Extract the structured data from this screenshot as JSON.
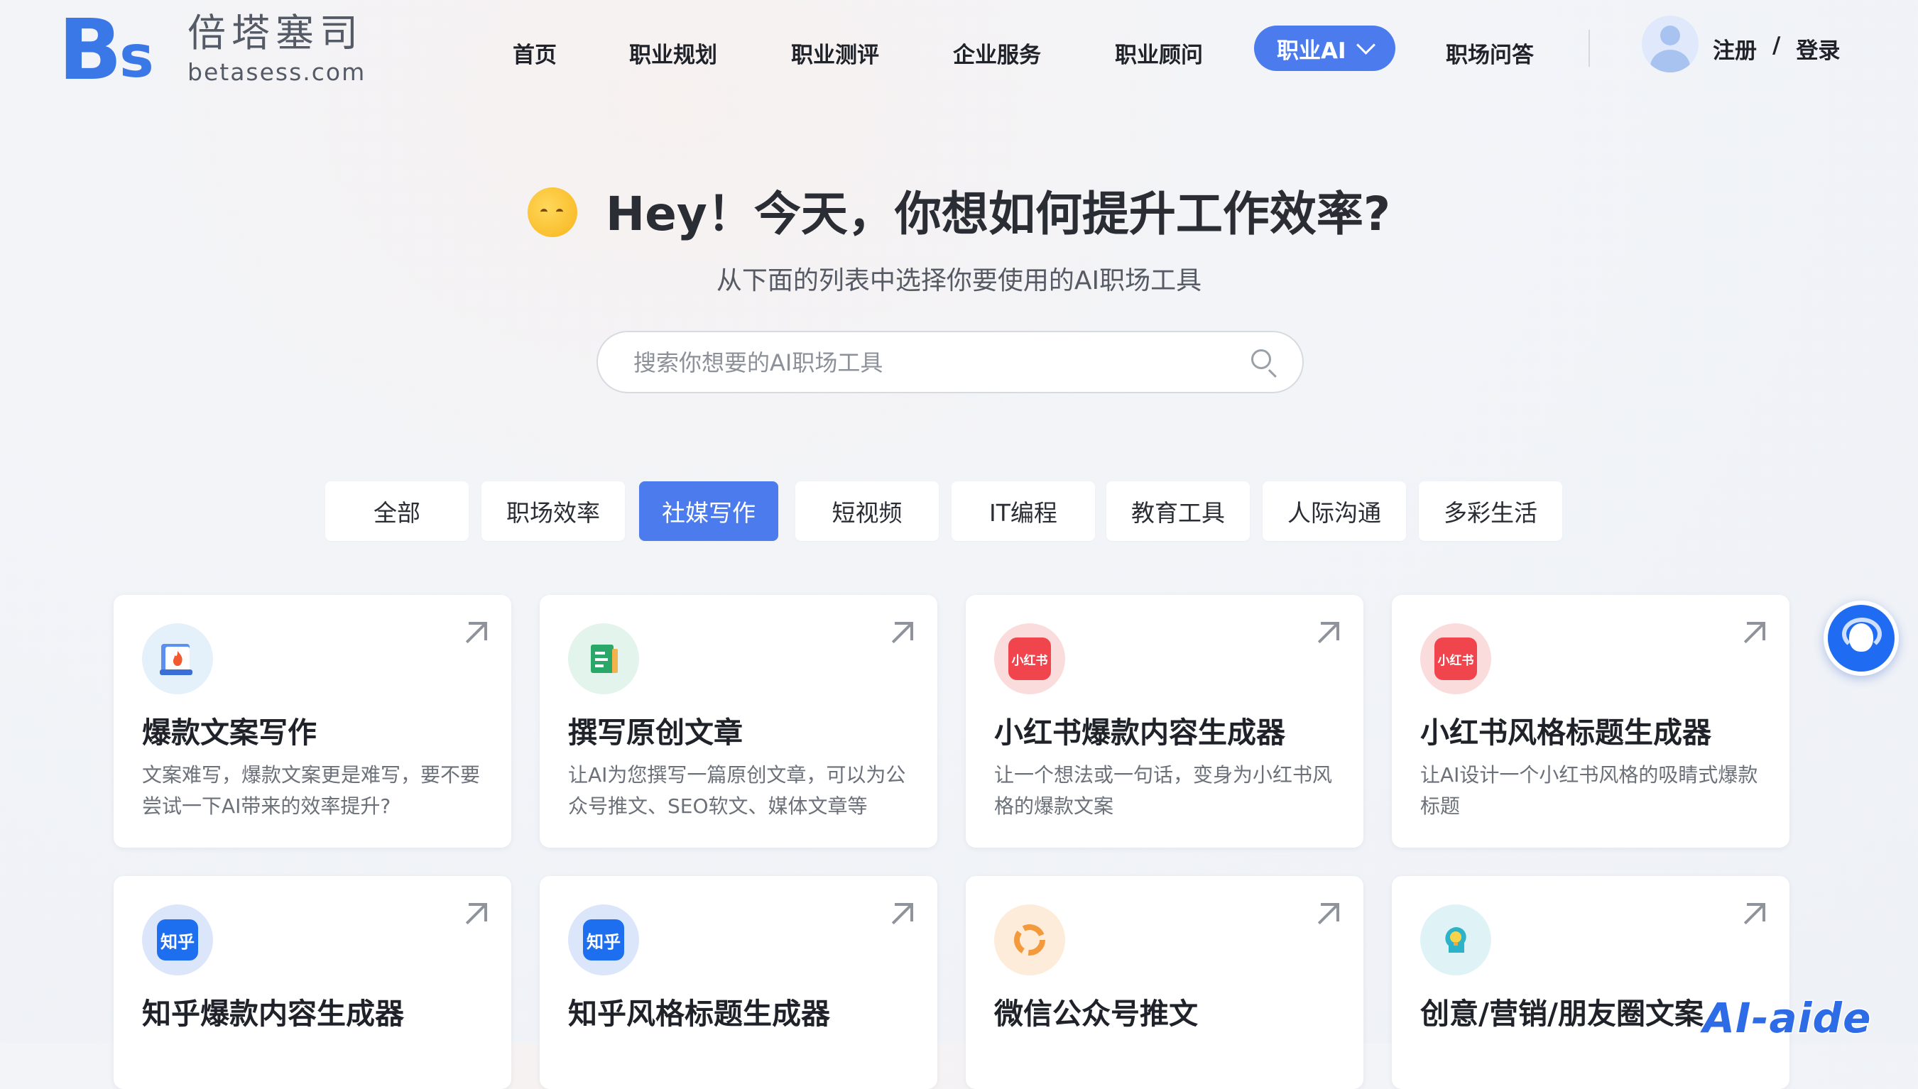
{
  "header": {
    "logo_cn": "倍塔塞司",
    "logo_en": "betasess.com",
    "nav": [
      "首页",
      "职业规划",
      "职业测评",
      "企业服务",
      "职业顾问",
      "职业AI",
      "职场问答"
    ],
    "active_nav": "职业AI",
    "register": "注册",
    "separator": "/",
    "login": "登录"
  },
  "hero": {
    "title": "Hey！今天，你想如何提升工作效率?",
    "subtitle": "从下面的列表中选择你要使用的AI职场工具",
    "search_placeholder": "搜索你想要的AI职场工具"
  },
  "tabs": [
    "全部",
    "职场效率",
    "社媒写作",
    "短视频",
    "IT编程",
    "教育工具",
    "人际沟通",
    "多彩生活"
  ],
  "active_tab": "社媒写作",
  "cards": [
    {
      "title": "爆款文案写作",
      "desc": "文案难写，爆款文案更是难写，要不要尝试一下AI带来的效率提升?",
      "icon": "fire-document-icon"
    },
    {
      "title": "撰写原创文章",
      "desc": "让AI为您撰写一篇原创文章，可以为公众号推文、SEO软文、媒体文章等",
      "icon": "document-icon"
    },
    {
      "title": "小红书爆款内容生成器",
      "desc": "让一个想法或一句话，变身为小红书风格的爆款文案",
      "icon": "xiaohongshu-icon",
      "icon_text": "小红书"
    },
    {
      "title": "小红书风格标题生成器",
      "desc": "让AI设计一个小红书风格的吸睛式爆款标题",
      "icon": "xiaohongshu-icon",
      "icon_text": "小红书"
    },
    {
      "title": "知乎爆款内容生成器",
      "desc": "",
      "icon": "zhihu-icon",
      "icon_text": "知乎"
    },
    {
      "title": "知乎风格标题生成器",
      "desc": "",
      "icon": "zhihu-icon",
      "icon_text": "知乎"
    },
    {
      "title": "微信公众号推文",
      "desc": "",
      "icon": "wechat-official-icon"
    },
    {
      "title": "创意/营销/朋友圈文案",
      "desc": "",
      "icon": "lightbulb-head-icon"
    }
  ],
  "watermark": "AI-aide",
  "colors": {
    "accent": "#4b7bec",
    "fab": "#1f6cf2",
    "xiaohongshu": "#f0454d",
    "zhihu": "#1e6ff0"
  }
}
